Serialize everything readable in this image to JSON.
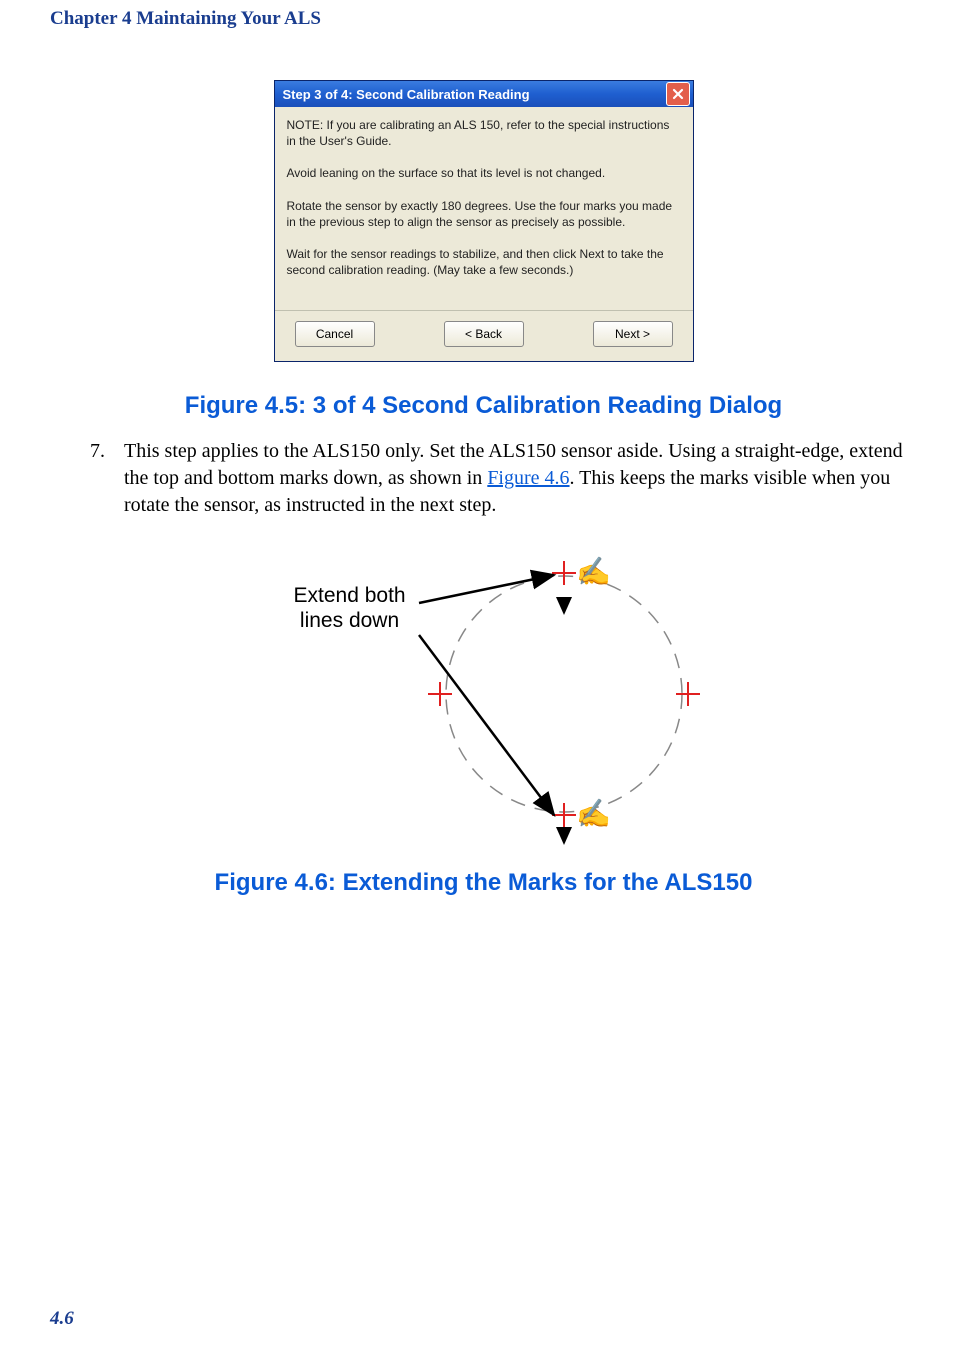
{
  "chapter_header": "Chapter 4  Maintaining Your ALS",
  "dialog": {
    "title": "Step 3 of 4:  Second Calibration Reading",
    "p1": "NOTE: If you are calibrating an ALS 150, refer to the special instructions in the User's Guide.",
    "p2": "Avoid leaning on the surface so that its level is not changed.",
    "p3": "Rotate the sensor by exactly 180 degrees.  Use the four marks you made in the previous step to align the sensor as precisely as possible.",
    "p4": "Wait for the sensor readings to stabilize, and then click Next to take the second calibration reading.  (May take a few seconds.)",
    "cancel": "Cancel",
    "back": "< Back",
    "next": "Next >"
  },
  "figure45_caption": "Figure 4.5: 3 of 4 Second Calibration Reading Dialog",
  "step7": {
    "num": "7.",
    "text_before": "This step applies to the ALS150 only. Set the ALS150 sensor aside. Using a straight-edge, extend the top and bottom marks down, as shown in ",
    "link": "Figure 4.6",
    "text_after": ". This keeps the marks visible when you rotate the sensor, as instructed in the next step."
  },
  "diagram_label_line1": "Extend both",
  "diagram_label_line2": "lines down",
  "figure46_caption": "Figure 4.6: Extending the Marks for the ALS150",
  "page_number": "4.6"
}
